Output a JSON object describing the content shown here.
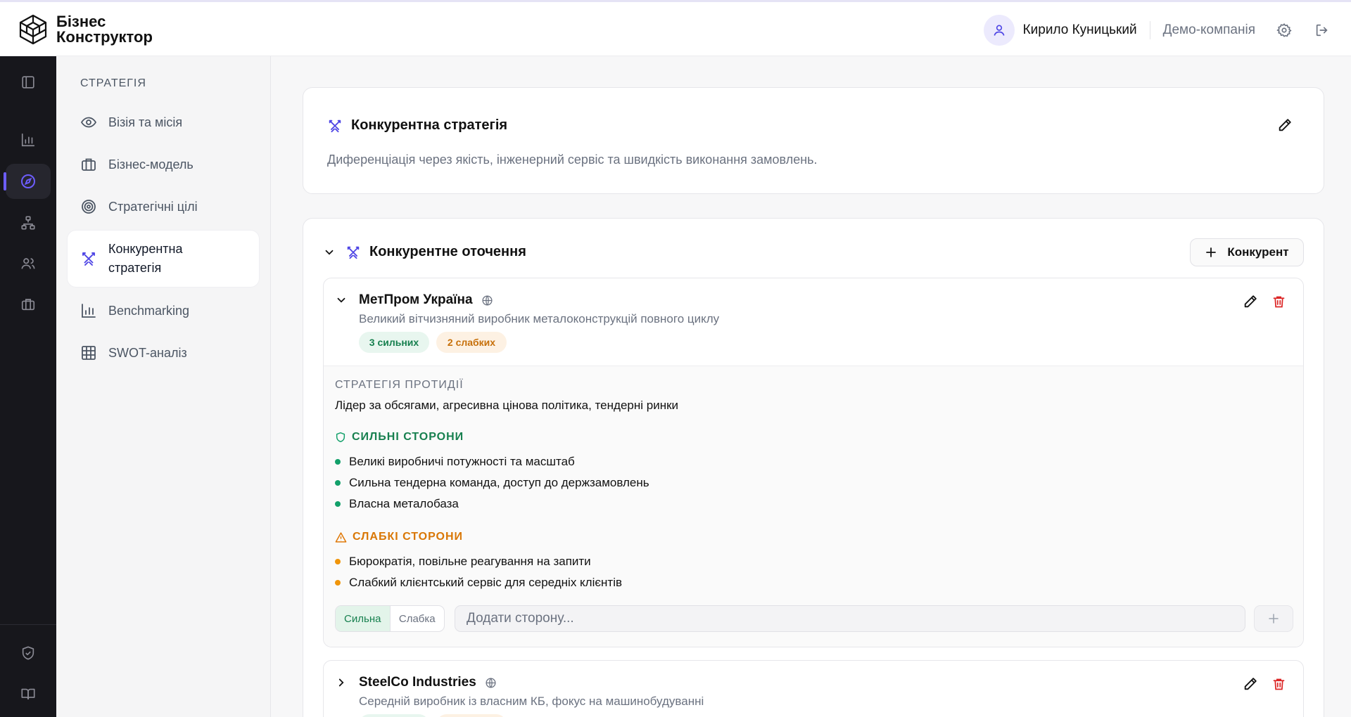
{
  "app": {
    "logo_line1": "Бізнес",
    "logo_line2": "Конструктор"
  },
  "header": {
    "user_name": "Кирило Куницький",
    "company": "Демо-компанія"
  },
  "rail": {
    "items": [
      "sidebar-toggle-icon",
      "analytics-icon",
      "compass-icon",
      "org-structure-icon",
      "users-icon",
      "briefcase-icon"
    ],
    "bottom_items": [
      "shield-check-icon",
      "book-icon"
    ],
    "active": "compass-icon"
  },
  "sidebar": {
    "title": "СТРАТЕГІЯ",
    "items": [
      {
        "label": "Візія та місія",
        "icon": "eye-icon"
      },
      {
        "label": "Бізнес-модель",
        "icon": "briefcase-icon"
      },
      {
        "label": "Стратегічні цілі",
        "icon": "target-icon"
      },
      {
        "label": "Конкурентна стратегія",
        "icon": "swords-icon",
        "active": true
      },
      {
        "label": "Benchmarking",
        "icon": "bar-chart-icon"
      },
      {
        "label": "SWOT-аналіз",
        "icon": "grid-icon"
      }
    ]
  },
  "strategy": {
    "title": "Конкурентна стратегія",
    "description": "Диференціація через якість, інженерний сервіс та швидкість виконання замовлень."
  },
  "environment": {
    "title": "Конкурентне оточення",
    "add_label": "Конкурент",
    "competitors": [
      {
        "name": "МетПром Україна",
        "description": "Великий вітчизняний виробник металоконструкцій повного циклу",
        "strong_badge": "3 сильних",
        "weak_badge": "2 слабких",
        "strategy_label": "СТРАТЕГІЯ ПРОТИДІЇ",
        "strategy_text": "Лідер за обсягами, агресивна цінова політика, тендерні ринки",
        "strengths_label": "СИЛЬНІ СТОРОНИ",
        "strengths": [
          "Великі виробничі потужності та масштаб",
          "Сильна тендерна команда, доступ до держзамовлень",
          "Власна металобаза"
        ],
        "weaknesses_label": "СЛАБКІ СТОРОНИ",
        "weaknesses": [
          "Бюрократія, повільне реагування на запити",
          "Слабкий клієнтський сервіс для середніх клієнтів"
        ],
        "toggle_strong": "Сильна",
        "toggle_weak": "Слабка",
        "input_placeholder": "Додати сторону..."
      },
      {
        "name": "SteelCo Industries",
        "description": "Середній виробник із власним КБ, фокус на машинобудуванні"
      }
    ]
  },
  "colors": {
    "accent": "#4f46e5",
    "danger": "#dc2626",
    "strong": "#12a06a",
    "weak": "#e07a0a"
  }
}
